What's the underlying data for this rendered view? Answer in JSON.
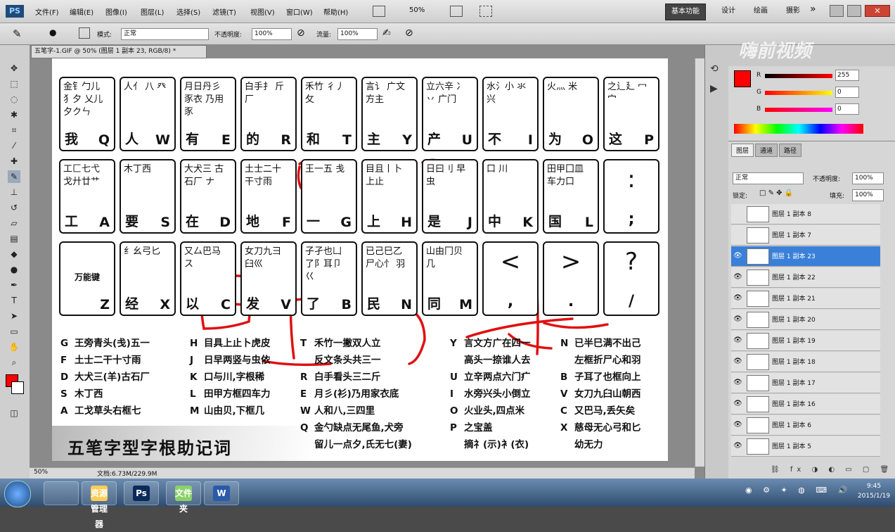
{
  "app": {
    "logo": "PS",
    "menus": [
      "文件(F)",
      "编辑(E)",
      "图像(I)",
      "图层(L)",
      "选择(S)",
      "滤镜(T)",
      "视图(V)",
      "窗口(W)",
      "帮助(H)"
    ],
    "zoom_top": "50%",
    "workspace_buttons": [
      "基本功能",
      "设计",
      "绘画",
      "摄影"
    ],
    "more": "»"
  },
  "options": {
    "mode_label": "模式:",
    "mode_value": "正常",
    "opacity_label": "不透明度:",
    "opacity_value": "100%",
    "flow_label": "流量:",
    "flow_value": "100%"
  },
  "document": {
    "tab_title": "五笔字-1.GIF @ 50% (图层 1 副本 23, RGB/8) *",
    "zoom": "50%",
    "doc_info": "文档:6.73M/229.9M",
    "title": "五笔字型字根助记词",
    "keys_row1": [
      {
        "roots": "金钅勹儿 犭夕 乂儿夕クㄣ",
        "char": "我",
        "letter": "Q"
      },
      {
        "roots": "人亻 八 癶",
        "char": "人",
        "letter": "W"
      },
      {
        "roots": "月日丹彡 豕衣 乃用豕",
        "char": "有",
        "letter": "E"
      },
      {
        "roots": "白手扌 斤 厂",
        "char": "的",
        "letter": "R"
      },
      {
        "roots": "禾竹 彳丿 攵",
        "char": "和",
        "letter": "T"
      },
      {
        "roots": "言讠 广文 方主",
        "char": "主",
        "letter": "Y"
      },
      {
        "roots": "立六辛 冫丷 广门",
        "char": "产",
        "letter": "U"
      },
      {
        "roots": "水氵小 氺 兴",
        "char": "不",
        "letter": "I"
      },
      {
        "roots": "火灬 米",
        "char": "为",
        "letter": "O"
      },
      {
        "roots": "之辶廴 冖宀",
        "char": "这",
        "letter": "P"
      }
    ],
    "keys_row2": [
      {
        "roots": "工匚七弋 戈廾廿艹",
        "char": "工",
        "letter": "A"
      },
      {
        "roots": "木丁西",
        "char": "要",
        "letter": "S"
      },
      {
        "roots": "大犬三 古石厂 ナ",
        "char": "在",
        "letter": "D"
      },
      {
        "roots": "土士二十 干寸雨",
        "char": "地",
        "letter": "F"
      },
      {
        "roots": "王一五 戋",
        "char": "一",
        "letter": "G"
      },
      {
        "roots": "目且丨卜 上止",
        "char": "上",
        "letter": "H"
      },
      {
        "roots": "日曰刂 早虫",
        "char": "是",
        "letter": "J"
      },
      {
        "roots": "口 川",
        "char": "中",
        "letter": "K"
      },
      {
        "roots": "田甲囗皿 车力口",
        "char": "国",
        "letter": "L"
      },
      {
        "roots": "",
        "char": "",
        "letter": "",
        "big": ":",
        "small": ";"
      }
    ],
    "keys_row3": [
      {
        "roots": "万能键",
        "char": "",
        "letter": "Z",
        "center": true
      },
      {
        "roots": "纟幺弓匕",
        "char": "经",
        "letter": "X"
      },
      {
        "roots": "又厶巴马 ス",
        "char": "以",
        "letter": "C"
      },
      {
        "roots": "女刀九彐 臼巛",
        "char": "发",
        "letter": "V"
      },
      {
        "roots": "子孑也凵 了阝耳卩 巜",
        "char": "了",
        "letter": "B"
      },
      {
        "roots": "已己巳乙 尸心忄 羽",
        "char": "民",
        "letter": "N"
      },
      {
        "roots": "山由冂贝 几",
        "char": "同",
        "letter": "M"
      },
      {
        "roots": "",
        "char": "",
        "letter": "",
        "big": "<",
        "small": ","
      },
      {
        "roots": "",
        "char": "",
        "letter": "",
        "big": ">",
        "small": "."
      },
      {
        "roots": "",
        "char": "",
        "letter": "",
        "big": "?",
        "small": "/"
      }
    ],
    "mnemonics_col1": [
      {
        "k": "G",
        "t": "王旁青头(戋)五一"
      },
      {
        "k": "F",
        "t": "土士二干十寸雨"
      },
      {
        "k": "D",
        "t": "大犬三(羊)古石厂"
      },
      {
        "k": "S",
        "t": "木丁西"
      },
      {
        "k": "A",
        "t": "工戈草头右框七"
      }
    ],
    "mnemonics_col2": [
      {
        "k": "H",
        "t": "目具上止卜虎皮"
      },
      {
        "k": "J",
        "t": "日早两竖与虫依"
      },
      {
        "k": "K",
        "t": "口与川,字根稀"
      },
      {
        "k": "L",
        "t": "田甲方框四车力"
      },
      {
        "k": "M",
        "t": "山由贝,下框几"
      }
    ],
    "mnemonics_col3": [
      {
        "k": "T",
        "t": "禾竹一撇双人立"
      },
      {
        "k": "",
        "t": "反文条头共三一"
      },
      {
        "k": "R",
        "t": "白手看头三二斤"
      },
      {
        "k": "E",
        "t": "月彡(衫)乃用家衣底"
      },
      {
        "k": "W",
        "t": "人和八,三四里"
      },
      {
        "k": "Q",
        "t": "金勺缺点无尾鱼,犬旁"
      },
      {
        "k": "",
        "t": "留儿一点夕,氏无七(妻)"
      }
    ],
    "mnemonics_col4": [
      {
        "k": "Y",
        "t": "言文方广在四一"
      },
      {
        "k": "",
        "t": "高头一捺谁人去"
      },
      {
        "k": "U",
        "t": "立辛两点六门疒"
      },
      {
        "k": "I",
        "t": "水旁兴头小倒立"
      },
      {
        "k": "O",
        "t": "火业头,四点米"
      },
      {
        "k": "P",
        "t": "之宝盖"
      },
      {
        "k": "",
        "t": "摘礻(示)衤(衣)"
      }
    ],
    "mnemonics_col5": [
      {
        "k": "N",
        "t": "已半巳满不出己"
      },
      {
        "k": "",
        "t": "左框折尸心和羽"
      },
      {
        "k": "B",
        "t": "子耳了也框向上"
      },
      {
        "k": "V",
        "t": "女刀九臼山朝西"
      },
      {
        "k": "C",
        "t": "又巴马,丢矢矣"
      },
      {
        "k": "X",
        "t": "慈母无心弓和匕"
      },
      {
        "k": "",
        "t": "幼无力"
      }
    ]
  },
  "color_panel": {
    "r_label": "R",
    "r_value": "255",
    "g_label": "G",
    "g_value": "0",
    "b_label": "B",
    "b_value": "0",
    "fg_color": "#ff0000"
  },
  "layers_panel": {
    "tabs": [
      "图层",
      "通道",
      "路径"
    ],
    "blend": "正常",
    "opacity_label": "不透明度:",
    "opacity": "100%",
    "lock_label": "锁定:",
    "fill_label": "填充:",
    "fill": "100%",
    "layers": [
      {
        "name": "图层 1 副本 8",
        "visible": false,
        "selected": false
      },
      {
        "name": "图层 1 副本 7",
        "visible": false,
        "selected": false
      },
      {
        "name": "图层 1 副本 23",
        "visible": true,
        "selected": true
      },
      {
        "name": "图层 1 副本 22",
        "visible": true,
        "selected": false
      },
      {
        "name": "图层 1 副本 21",
        "visible": true,
        "selected": false
      },
      {
        "name": "图层 1 副本 20",
        "visible": true,
        "selected": false
      },
      {
        "name": "图层 1 副本 19",
        "visible": true,
        "selected": false
      },
      {
        "name": "图层 1 副本 18",
        "visible": true,
        "selected": false
      },
      {
        "name": "图层 1 副本 17",
        "visible": true,
        "selected": false
      },
      {
        "name": "图层 1 副本 16",
        "visible": true,
        "selected": false
      },
      {
        "name": "图层 1 副本 6",
        "visible": true,
        "selected": false
      },
      {
        "name": "图层 1 副本 5",
        "visible": true,
        "selected": false
      }
    ]
  },
  "taskbar": {
    "time": "9:45",
    "date": "2015/1/19",
    "apps": [
      "资源管理器",
      "Ps",
      "文件夹",
      "W"
    ]
  },
  "watermark": "嗨前视频"
}
